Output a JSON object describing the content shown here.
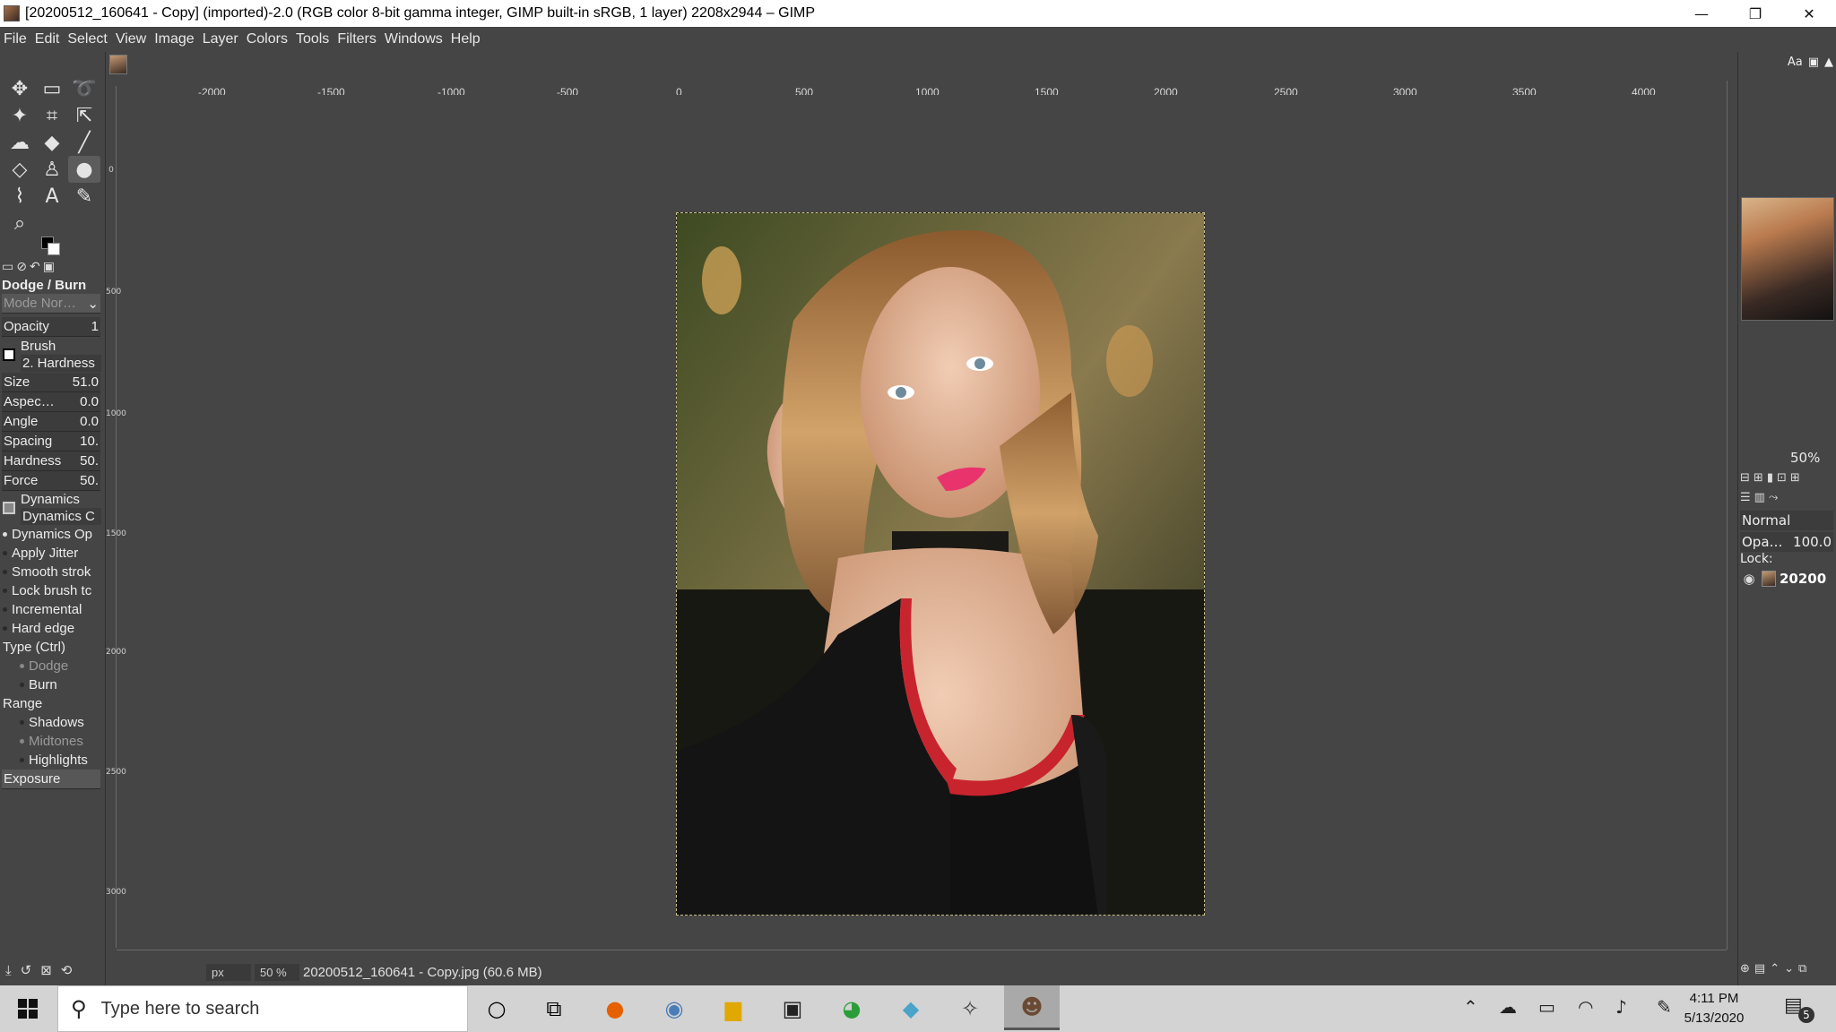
{
  "window": {
    "title": "[20200512_160641 - Copy] (imported)-2.0 (RGB color 8-bit gamma integer, GIMP built-in sRGB, 1 layer) 2208x2944 – GIMP",
    "minimize_glyph": "—",
    "restore_glyph": "❐",
    "close_glyph": "✕"
  },
  "menubar": [
    "File",
    "Edit",
    "Select",
    "View",
    "Image",
    "Layer",
    "Colors",
    "Tools",
    "Filters",
    "Windows",
    "Help"
  ],
  "tool_options": {
    "title": "Dodge / Burn",
    "mode_label": "Mode Nor…",
    "opacity_label": "Opacity",
    "opacity_value": "1",
    "brush_label": "Brush",
    "brush_name": "2. Hardness",
    "size_label": "Size",
    "size_value": "51.0",
    "aspect_label": "Aspec…",
    "aspect_value": "0.0",
    "angle_label": "Angle",
    "angle_value": "0.0",
    "spacing_label": "Spacing",
    "spacing_value": "10.",
    "hardness_label": "Hardness",
    "hardness_value": "50.",
    "force_label": "Force",
    "force_value": "50.",
    "dynamics_label": "Dynamics",
    "dynamics_name": "Dynamics C",
    "dynamics_options": "Dynamics Op",
    "apply_jitter": "Apply Jitter",
    "smooth_stroke": "Smooth strok",
    "lock_brush": "Lock brush tc",
    "incremental": "Incremental",
    "hard_edge": "Hard edge",
    "type_label": "Type  (Ctrl)",
    "type_dodge": "Dodge",
    "type_burn": "Burn",
    "range_label": "Range",
    "range_shadows": "Shadows",
    "range_midtones": "Midtones",
    "range_highlights": "Highlights",
    "exposure_label": "Exposure"
  },
  "ruler": {
    "h_labels": [
      "-2000",
      "-1500",
      "-1000",
      "-500",
      "0",
      "500",
      "1000",
      "1500",
      "2000",
      "2500",
      "3000",
      "3500",
      "4000"
    ],
    "v_labels": [
      "0",
      "500",
      "1000",
      "1500",
      "2000",
      "2500",
      "3000"
    ]
  },
  "statusbar": {
    "unit": "px",
    "zoom": "50 %",
    "file_info": "20200512_160641 - Copy.jpg (60.6 MB)"
  },
  "dock": {
    "zoom": "50%",
    "layer_mode": "Normal",
    "opacity_label": "Opa…",
    "opacity_value": "100.0",
    "lock_label": "Lock:",
    "layer_name": "20200"
  },
  "taskbar": {
    "search_placeholder": "Type here to search",
    "time": "4:11 PM",
    "date": "5/13/2020",
    "notification_count": "5"
  },
  "colors": {
    "canvas_bg": "#454545",
    "panel_bg": "#454545",
    "taskbar_bg": "#d3d3d3"
  }
}
